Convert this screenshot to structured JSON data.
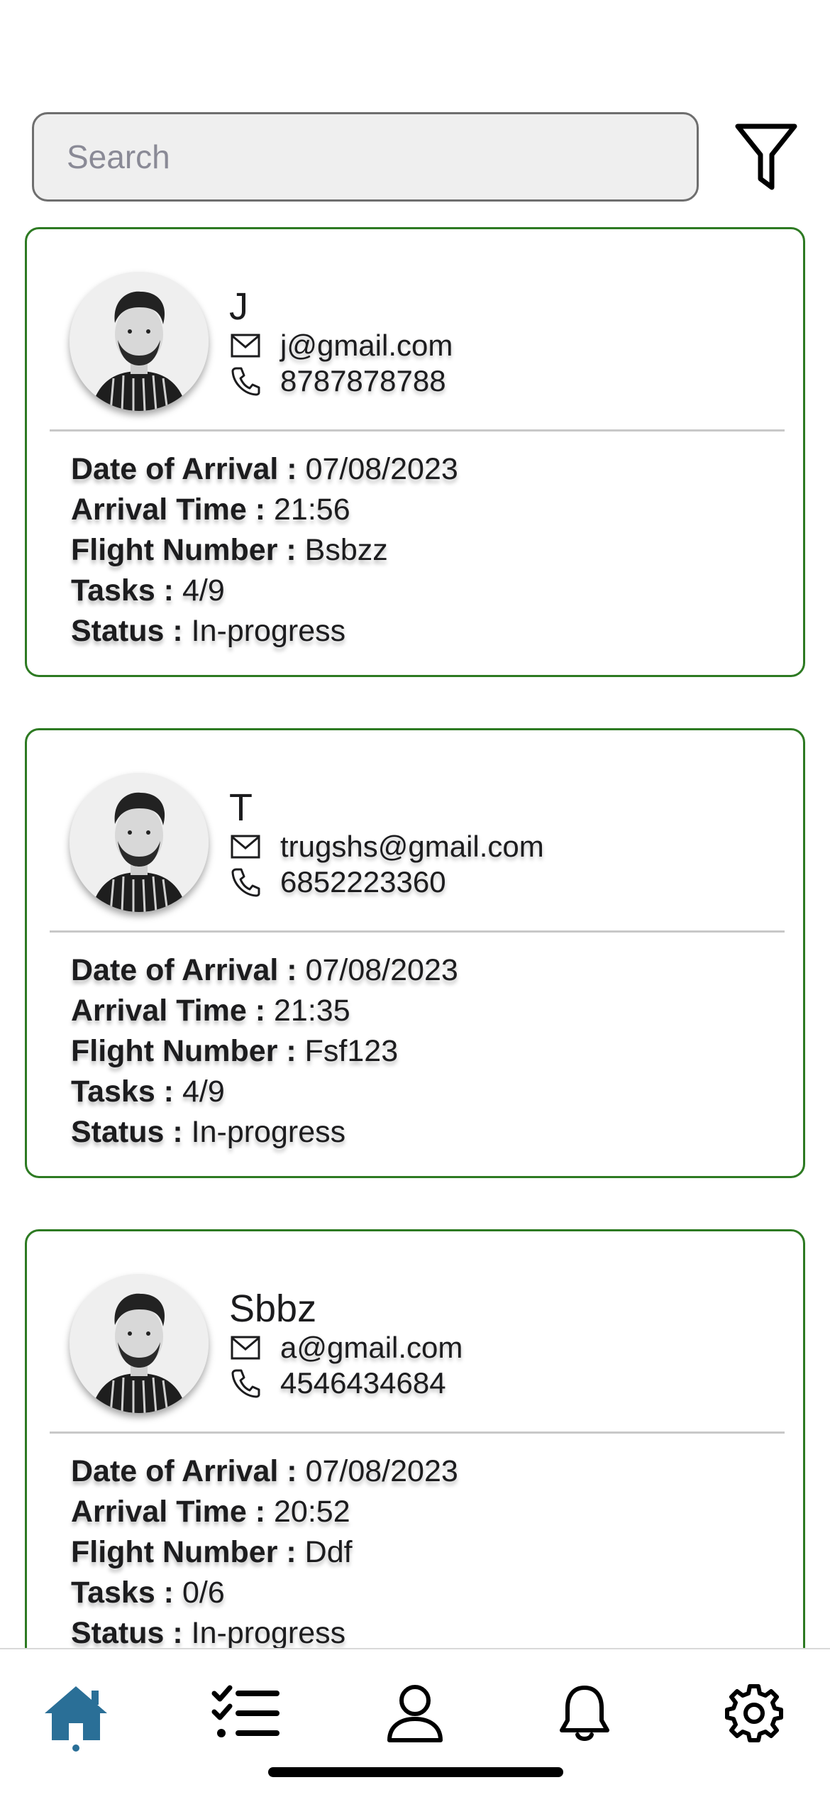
{
  "search": {
    "placeholder": "Search",
    "value": ""
  },
  "colors": {
    "card_border": "#2d7a22",
    "active_tab": "#2a6f97"
  },
  "cards": [
    {
      "name": "J",
      "email": "j@gmail.com",
      "phone": "8787878788",
      "details": [
        {
          "label": "Date of Arrival :",
          "value": "07/08/2023"
        },
        {
          "label": "Arrival Time :",
          "value": "21:56"
        },
        {
          "label": "Flight Number :",
          "value": "Bsbzz"
        },
        {
          "label": "Tasks :",
          "value": "4/9"
        },
        {
          "label": "Status :",
          "value": "In-progress"
        }
      ]
    },
    {
      "name": "T",
      "email": "trugshs@gmail.com",
      "phone": "6852223360",
      "details": [
        {
          "label": "Date of Arrival :",
          "value": "07/08/2023"
        },
        {
          "label": "Arrival Time :",
          "value": "21:35"
        },
        {
          "label": "Flight Number :",
          "value": "Fsf123"
        },
        {
          "label": "Tasks :",
          "value": "4/9"
        },
        {
          "label": "Status :",
          "value": "In-progress"
        }
      ]
    },
    {
      "name": "Sbbz",
      "email": "a@gmail.com",
      "phone": "4546434684",
      "details": [
        {
          "label": "Date of Arrival :",
          "value": "07/08/2023"
        },
        {
          "label": "Arrival Time :",
          "value": "20:52"
        },
        {
          "label": "Flight Number :",
          "value": "Ddf"
        },
        {
          "label": "Tasks :",
          "value": "0/6"
        },
        {
          "label": "Status :",
          "value": "In-progress"
        }
      ]
    }
  ],
  "tabs": [
    {
      "icon": "home-icon",
      "active": true
    },
    {
      "icon": "checklist-icon",
      "active": false
    },
    {
      "icon": "user-icon",
      "active": false
    },
    {
      "icon": "bell-icon",
      "active": false
    },
    {
      "icon": "gear-icon",
      "active": false
    }
  ]
}
